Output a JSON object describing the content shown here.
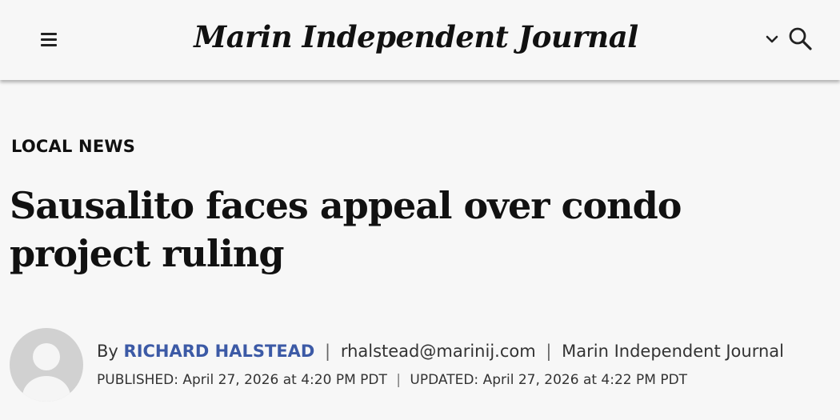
{
  "header": {
    "logo_text": "Marin Independent Journal",
    "menu_icon": "hamburger-menu-icon",
    "chevron_icon": "chevron-down-icon",
    "search_icon": "search-icon"
  },
  "article": {
    "section": "LOCAL NEWS",
    "headline": "Sausalito faces appeal over condo project ruling",
    "byline": {
      "prefix": "By",
      "author": "RICHARD HALSTEAD",
      "separator": "|",
      "email": "rhalstead@marinij.com",
      "publication": "Marin Independent Journal"
    },
    "dates": {
      "published_label": "Published:",
      "published_value": "April 27, 2026 at 4:20 PM PDT",
      "separator": "|",
      "updated_label": "Updated:",
      "updated_value": "April 27, 2026 at 4:22 PM PDT"
    }
  },
  "colors": {
    "author_link": "#3c5aa6",
    "avatar_bg": "#d1d1d1",
    "page_bg": "#f7f7f7"
  }
}
